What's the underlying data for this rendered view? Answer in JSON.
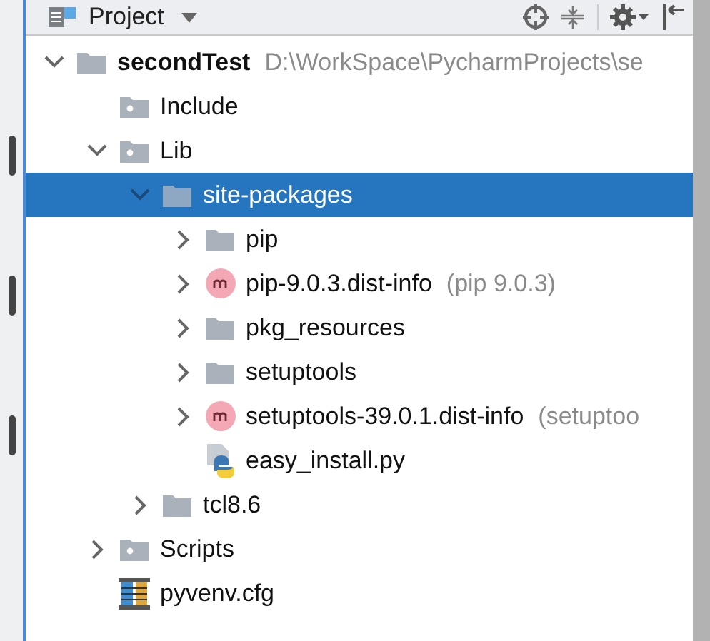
{
  "header": {
    "title": "Project"
  },
  "tree": [
    {
      "kind": "module",
      "label": "secondTest",
      "hint": "D:\\WorkSpace\\PycharmProjects\\se",
      "expanded": true,
      "selected": false,
      "children": [
        {
          "kind": "excluded-folder",
          "label": "Include",
          "selected": false
        },
        {
          "kind": "excluded-folder",
          "label": "Lib",
          "expanded": true,
          "selected": false,
          "children": [
            {
              "kind": "folder",
              "label": "site-packages",
              "expanded": true,
              "selected": true,
              "children": [
                {
                  "kind": "folder",
                  "label": "pip",
                  "expanded": false,
                  "selected": false
                },
                {
                  "kind": "package",
                  "label": "pip-9.0.3.dist-info",
                  "hint": "(pip 9.0.3)",
                  "expanded": false,
                  "selected": false
                },
                {
                  "kind": "folder",
                  "label": "pkg_resources",
                  "expanded": false,
                  "selected": false
                },
                {
                  "kind": "folder",
                  "label": "setuptools",
                  "expanded": false,
                  "selected": false
                },
                {
                  "kind": "package",
                  "label": "setuptools-39.0.1.dist-info",
                  "hint": "(setuptoo",
                  "expanded": false,
                  "selected": false
                },
                {
                  "kind": "python-file",
                  "label": "easy_install.py",
                  "selected": false
                }
              ]
            },
            {
              "kind": "folder",
              "label": "tcl8.6",
              "expanded": false,
              "selected": false
            }
          ]
        },
        {
          "kind": "excluded-folder",
          "label": "Scripts",
          "expanded": false,
          "selected": false
        },
        {
          "kind": "config-file",
          "label": "pyvenv.cfg",
          "selected": false
        }
      ]
    }
  ]
}
